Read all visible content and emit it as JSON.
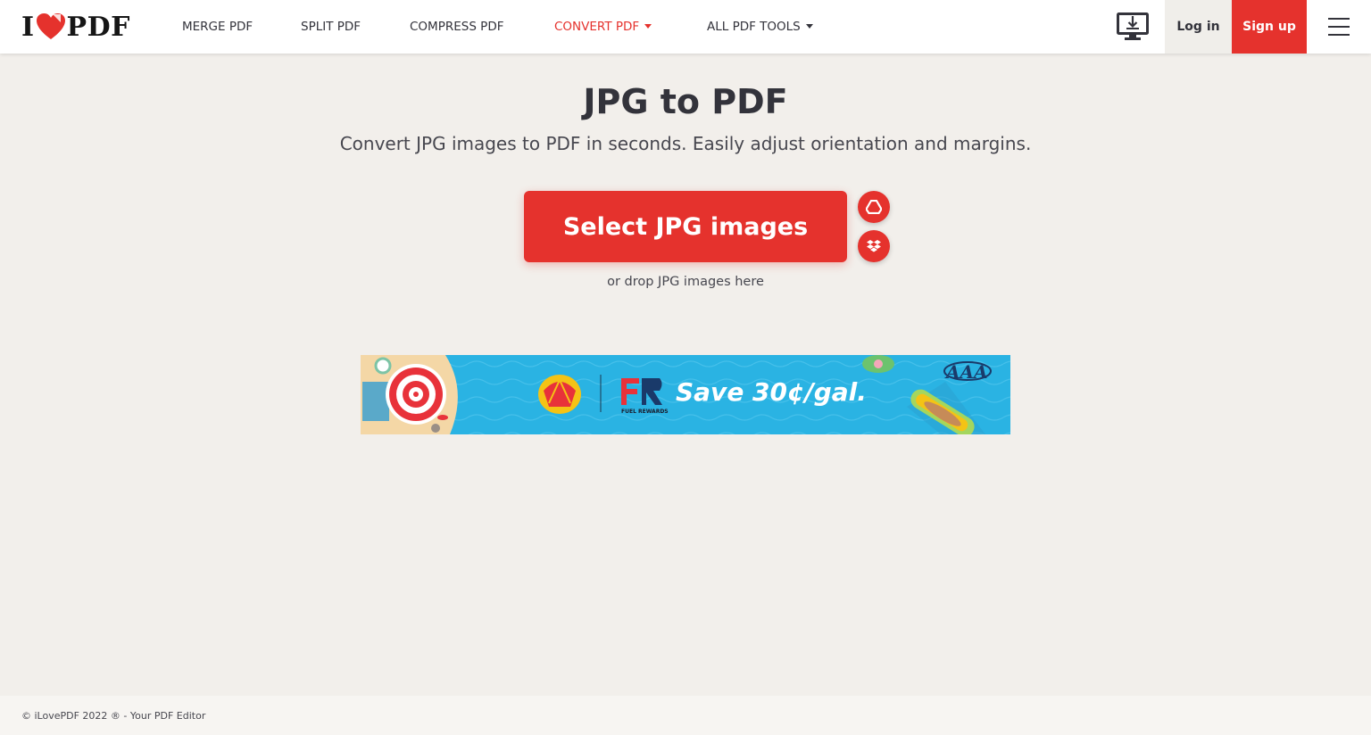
{
  "header": {
    "logo": {
      "left": "I",
      "right": "PDF"
    },
    "nav": [
      {
        "label": "MERGE PDF"
      },
      {
        "label": "SPLIT PDF"
      },
      {
        "label": "COMPRESS PDF"
      },
      {
        "label": "CONVERT PDF",
        "has_caret": true,
        "active": true
      },
      {
        "label": "ALL PDF TOOLS",
        "has_caret": true
      }
    ],
    "desktop_icon": "desktop-download-icon",
    "login_label": "Log in",
    "signup_label": "Sign up",
    "menu_icon": "hamburger-menu-icon"
  },
  "main": {
    "title": "JPG to PDF",
    "subtitle": "Convert JPG images to PDF in seconds. Easily adjust orientation and margins.",
    "select_button_label": "Select JPG images",
    "cloud_icons": [
      "google-drive-icon",
      "dropbox-icon"
    ],
    "drop_text": "or drop JPG images here"
  },
  "ad": {
    "text": "Save 30¢/gal.",
    "fuel_rewards": "FUEL REWARDS"
  },
  "footer": {
    "text": "© iLovePDF 2022 ® - Your PDF Editor"
  },
  "colors": {
    "brand_red": "#e5322d",
    "background": "#f2efeb",
    "text": "#33333b"
  }
}
